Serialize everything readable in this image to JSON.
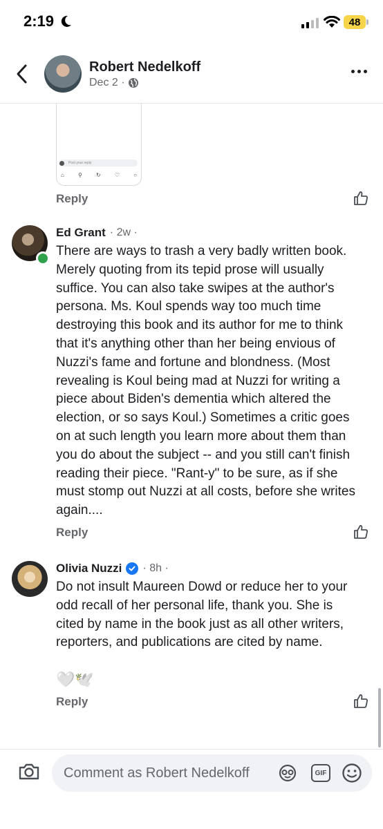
{
  "status_bar": {
    "time": "2:19",
    "battery": "48"
  },
  "header": {
    "name": "Robert Nedelkoff",
    "meta": "Dec 2 ·"
  },
  "embedded_card": {
    "input_placeholder": "Post your reply"
  },
  "first_reply_label": "Reply",
  "comments": [
    {
      "author": "Ed Grant",
      "time": "· 2w ·",
      "text": "There are ways to trash a very badly written book. Merely quoting from its tepid prose will usually suffice. You can also take swipes at the author's persona. Ms. Koul spends way too much time destroying this book and its author for me to think that it's anything other than her being envious of Nuzzi's fame and fortune and blondness. (Most revealing is Koul being mad at Nuzzi for writing a piece about Biden's dementia which altered the election, or so says Koul.) Sometimes a critic goes on at such length you learn more about them than you do about the subject -- and you still can't finish reading their piece. \"Rant-y\" to be sure, as if she must stomp out Nuzzi at all costs, before she writes again....",
      "reply_label": "Reply"
    },
    {
      "author": "Olivia Nuzzi",
      "time": "· 8h ·",
      "text": "Do not insult Maureen Dowd or reduce her to your odd recall of her personal life, thank you. She is cited by name in the book just as all other writers, reporters, and publications are cited by name.",
      "reactions": "🤍🕊️",
      "reply_label": "Reply"
    }
  ],
  "composer": {
    "placeholder": "Comment as Robert Nedelkoff",
    "gif_label": "GIF"
  }
}
